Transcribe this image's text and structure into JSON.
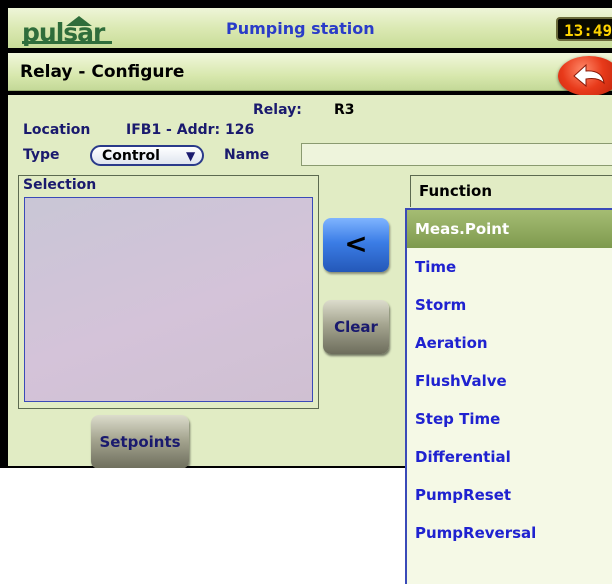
{
  "topbar": {
    "logo": "pulsar",
    "title": "Pumping station",
    "clock": "13:49"
  },
  "header": {
    "title": "Relay - Configure"
  },
  "form": {
    "relay_label": "Relay:",
    "relay_value": "R3",
    "location_label": "Location",
    "location_value": "IFB1 - Addr: 126",
    "type_label": "Type",
    "type_value": "Control",
    "name_label": "Name",
    "name_value": ""
  },
  "selection": {
    "title": "Selection",
    "items": []
  },
  "buttons": {
    "move": "<",
    "clear": "Clear",
    "setpoints": "Setpoints"
  },
  "function": {
    "title": "Function",
    "items": [
      "Meas.Point",
      "Time",
      "Storm",
      "Aeration",
      "FlushValve",
      "Step Time",
      "Differential",
      "PumpReset",
      "PumpReversal"
    ],
    "selected_index": 0
  },
  "colors": {
    "accent_blue": "#2a3cc8",
    "selected_green": "#7e9a4e",
    "panel_bg": "#e1ecc4"
  }
}
